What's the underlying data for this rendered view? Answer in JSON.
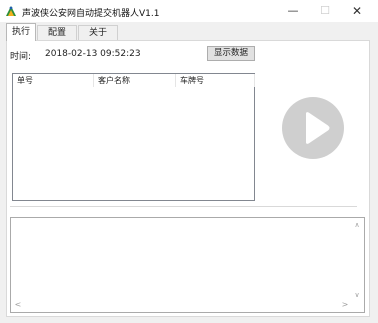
{
  "window": {
    "title": "声波侠公安网自动提交机器人V1.1",
    "minimize_label": "—",
    "maximize_label": "☐",
    "close_label": "✕"
  },
  "tabs": [
    {
      "label": "执行",
      "active": true
    },
    {
      "label": "配置",
      "active": false
    },
    {
      "label": "关于",
      "active": false
    }
  ],
  "execute": {
    "time_label": "时间:",
    "time_value": "2018-02-13 09:52:23",
    "show_data_label": "显示数据",
    "columns": [
      "单号",
      "客户名称",
      "车牌号"
    ],
    "rows": []
  },
  "log": {
    "text": ""
  },
  "icons": {
    "app": "app-logo-icon",
    "play": "play-icon",
    "scroll_up": "chevron-up-icon",
    "scroll_down": "chevron-down-icon",
    "scroll_left": "chevron-left-icon",
    "scroll_right": "chevron-right-icon"
  },
  "colors": {
    "play_circle": "#cfcfcf",
    "play_triangle": "#ffffff",
    "window_bg": "#f0f0f0"
  }
}
